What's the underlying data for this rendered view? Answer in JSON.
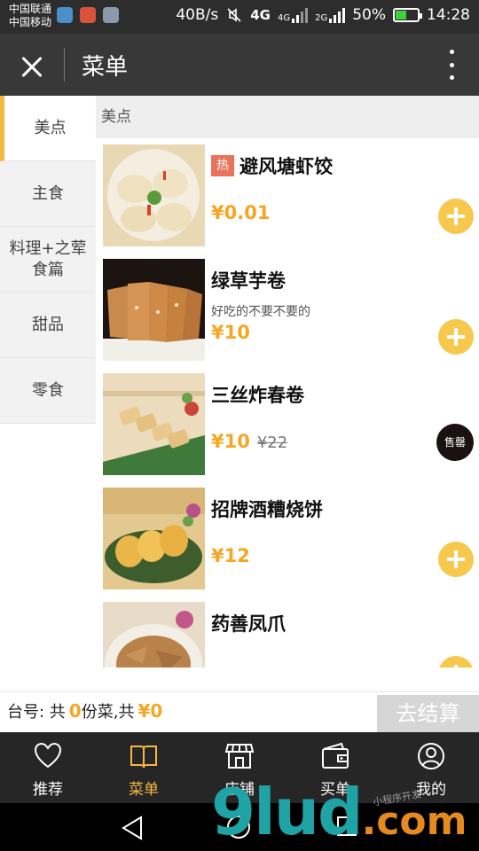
{
  "status_bar": {
    "carrier_1": "中国联通",
    "carrier_2": "中国移动",
    "net_speed": "40B/s",
    "net_4g": "4G",
    "net_4g_small": "4G",
    "net_2g": "2G",
    "battery": "50%",
    "battery_level": 0.5,
    "time": "14:28"
  },
  "title_bar": {
    "title": "菜单"
  },
  "sidebar": {
    "categories": [
      {
        "label": "美点",
        "active": true
      },
      {
        "label": "主食"
      },
      {
        "label": "料理+之荤食篇"
      },
      {
        "label": "甜品"
      },
      {
        "label": "零食"
      }
    ]
  },
  "menu": {
    "section_title": "美点",
    "dishes": [
      {
        "badge": "热",
        "name": "避风塘虾饺",
        "price": "¥0.01",
        "action": "add"
      },
      {
        "name": "绿草芋卷",
        "desc": "好吃的不要不要的",
        "price": "¥10",
        "action": "add"
      },
      {
        "name": "三丝炸春卷",
        "price": "¥10",
        "old_price": "¥22",
        "action": "sold_out",
        "sold_out_label": "售罄"
      },
      {
        "name": "招牌酒糟烧饼",
        "price": "¥12",
        "action": "add"
      },
      {
        "name": "药善凤爪"
      }
    ]
  },
  "cart": {
    "label_prefix": "台号: 共",
    "count": "0",
    "label_mid": "份菜,共",
    "total": "¥0",
    "checkout_label": "去结算"
  },
  "tabs": [
    {
      "label": "推荐",
      "icon": "heart-icon"
    },
    {
      "label": "菜单",
      "icon": "book-icon",
      "active": true
    },
    {
      "label": "店铺",
      "icon": "store-icon"
    },
    {
      "label": "买单",
      "icon": "wallet-icon"
    },
    {
      "label": "我的",
      "icon": "user-icon"
    }
  ],
  "watermark": {
    "text": "9lud",
    "domain": ".com",
    "small": "小程序开发"
  },
  "colors": {
    "accent": "#f5b740",
    "price": "#f5a623",
    "hot_badge": "#e8735a",
    "add_button": "#f6c84e"
  }
}
